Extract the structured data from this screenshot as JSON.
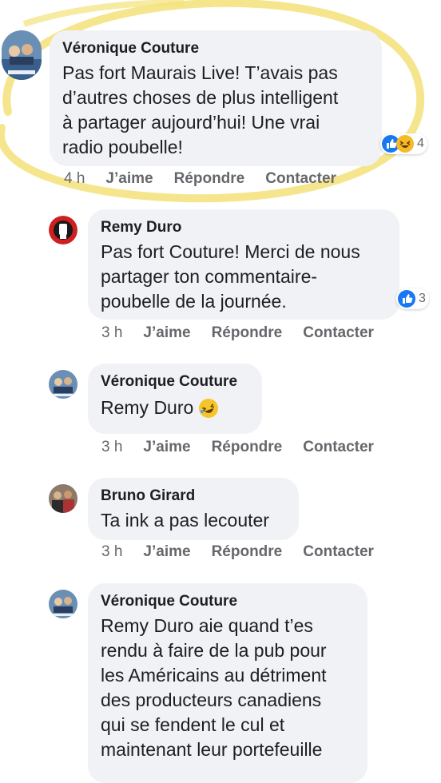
{
  "comments": [
    {
      "author": "Véronique Couture",
      "text": "Pas fort Maurais Live! T’avais pas\nd’autres choses de plus intelligent\nà partager aujourd’hui! Une vrai\nradio poubelle!",
      "time": "4 h",
      "like": "J’aime",
      "reply": "Répondre",
      "contact": "Contacter",
      "reactions": "4"
    },
    {
      "author": "Remy Duro",
      "text": "Pas fort Couture! Merci de nous\npartager ton commentaire-\npoubelle de la journée.",
      "time": "3 h",
      "like": "J’aime",
      "reply": "Répondre",
      "contact": "Contacter",
      "reactions": "3"
    },
    {
      "author": "Véronique Couture",
      "text": "Remy Duro",
      "time": "3 h",
      "like": "J’aime",
      "reply": "Répondre",
      "contact": "Contacter"
    },
    {
      "author": "Bruno Girard",
      "text": "Ta ink a pas lecouter",
      "time": "3 h",
      "like": "J’aime",
      "reply": "Répondre",
      "contact": "Contacter"
    },
    {
      "author": "Véronique Couture",
      "text": "Remy Duro aie quand t’es\nrendu à faire de la pub pour\nles Américains au détriment\ndes producteurs canadiens\nqui se fendent le cul et\nmaintenant leur portefeuille"
    }
  ],
  "colors": {
    "bubble": "#f0f2f5",
    "like_blue": "#1877f2",
    "highlight": "#f3e27a",
    "muted": "#65676b"
  },
  "icons": [
    "like-reaction-icon",
    "haha-reaction-icon",
    "rofl-emoji-icon"
  ]
}
